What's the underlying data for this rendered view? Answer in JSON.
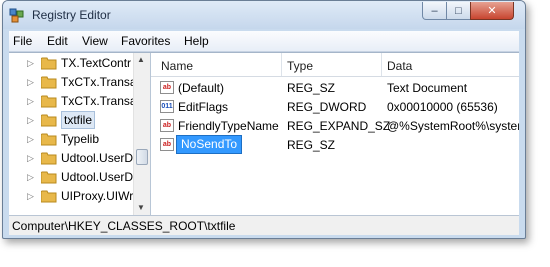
{
  "window": {
    "title": "Registry Editor"
  },
  "caption_buttons": {
    "minimize": "–",
    "maximize": "□",
    "close": "✕"
  },
  "menu": [
    "File",
    "Edit",
    "View",
    "Favorites",
    "Help"
  ],
  "tree": {
    "items": [
      {
        "label": "TX.TextContr",
        "selected": false
      },
      {
        "label": "TxCTx.Transa",
        "selected": false
      },
      {
        "label": "TxCTx.Transa",
        "selected": false
      },
      {
        "label": "txtfile",
        "selected": true
      },
      {
        "label": "Typelib",
        "selected": false
      },
      {
        "label": "Udtool.UserD",
        "selected": false
      },
      {
        "label": "Udtool.UserD",
        "selected": false
      },
      {
        "label": "UIProxy.UIWr",
        "selected": false
      }
    ]
  },
  "list": {
    "columns": [
      "Name",
      "Type",
      "Data"
    ],
    "rows": [
      {
        "icon": "string-value-icon",
        "name": "(Default)",
        "type": "REG_SZ",
        "data": "Text Document",
        "selected": false
      },
      {
        "icon": "dword-value-icon",
        "name": "EditFlags",
        "type": "REG_DWORD",
        "data": "0x00010000 (65536)",
        "selected": false
      },
      {
        "icon": "string-value-icon",
        "name": "FriendlyTypeName",
        "type": "REG_EXPAND_SZ",
        "data": "@%SystemRoot%\\systen",
        "selected": false
      },
      {
        "icon": "string-value-icon",
        "name": "NoSendTo",
        "type": "REG_SZ",
        "data": "",
        "selected": true
      }
    ]
  },
  "status": {
    "path": "Computer\\HKEY_CLASSES_ROOT\\txtfile"
  },
  "colors": {
    "selection": "#3399ff",
    "folder": "#e8b84a",
    "title_bar": "#c5d7ec"
  }
}
